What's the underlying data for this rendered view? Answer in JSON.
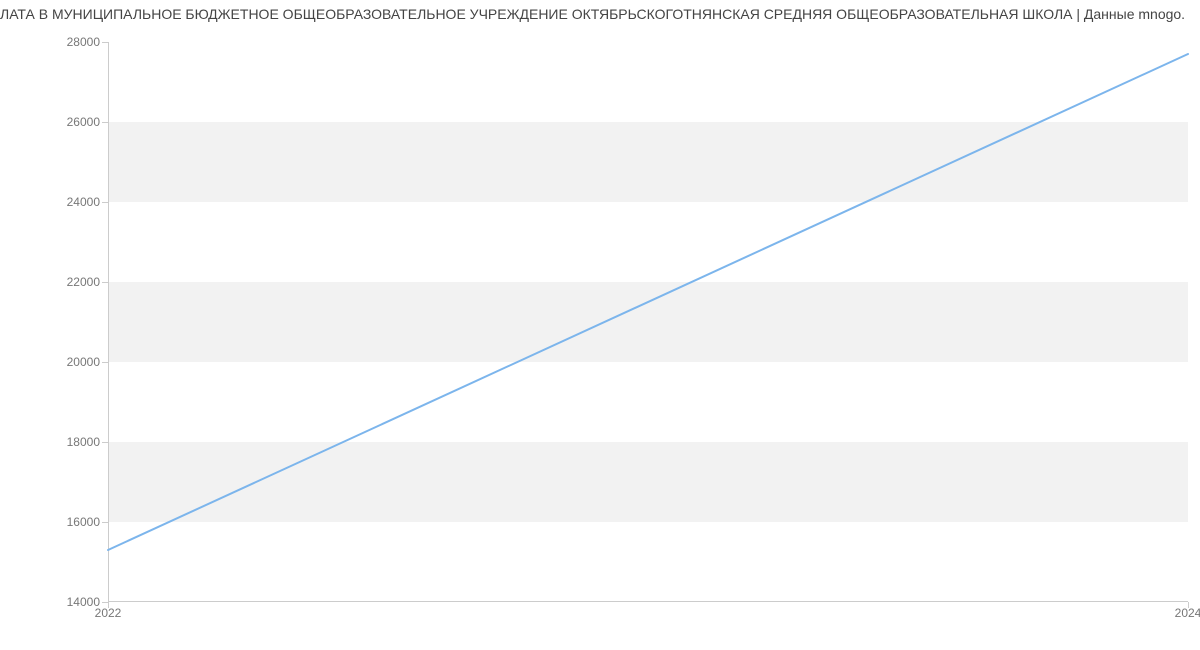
{
  "chart_data": {
    "type": "line",
    "title": "ЛАТА В МУНИЦИПАЛЬНОЕ БЮДЖЕТНОЕ ОБЩЕОБРАЗОВАТЕЛЬНОЕ УЧРЕЖДЕНИЕ ОКТЯБРЬСКОГОТНЯНСКАЯ СРЕДНЯЯ ОБЩЕОБРАЗОВАТЕЛЬНАЯ ШКОЛА | Данные mnogo.",
    "xlabel": "",
    "ylabel": "",
    "x": [
      2022,
      2024
    ],
    "values": [
      15300,
      27700
    ],
    "xlim": [
      2022,
      2024
    ],
    "ylim": [
      14000,
      28000
    ],
    "x_ticks": [
      2022,
      2024
    ],
    "y_ticks": [
      14000,
      16000,
      18000,
      20000,
      22000,
      24000,
      26000,
      28000
    ],
    "line_color": "#7cb5ec"
  }
}
